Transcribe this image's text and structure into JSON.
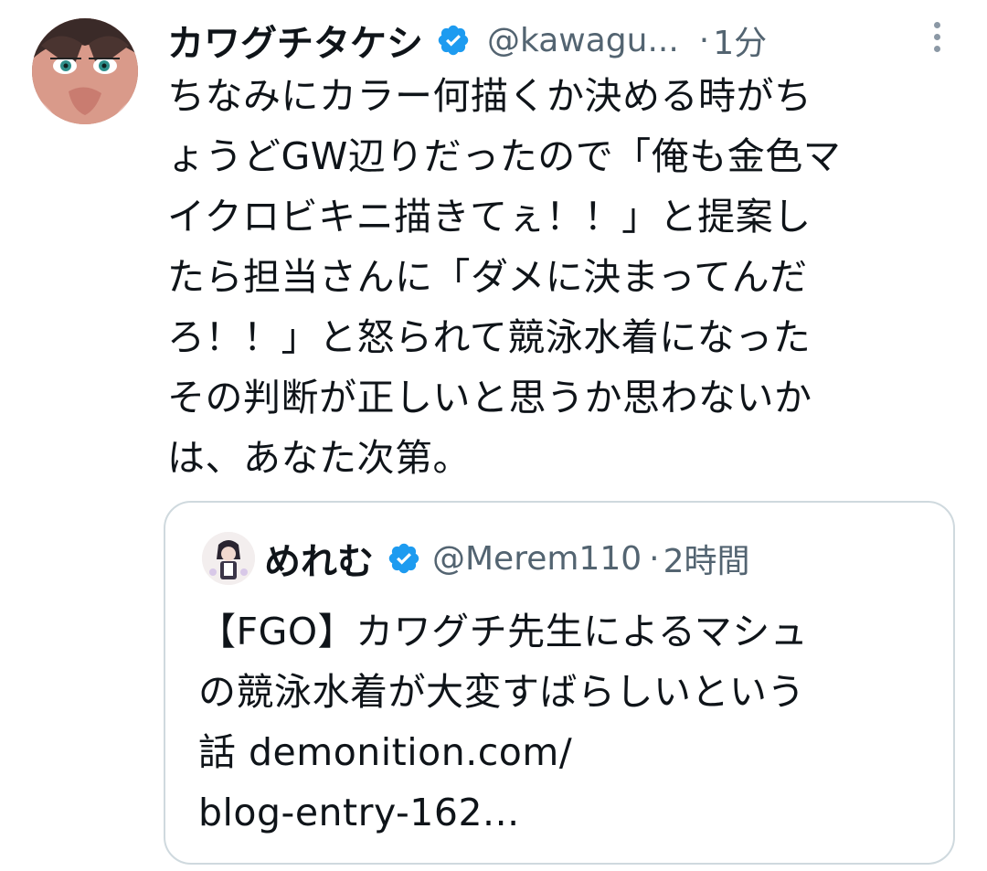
{
  "tweet": {
    "author": {
      "name": "カワグチタケシ",
      "handle": "@kawagu...",
      "time": "1分",
      "separator": "·"
    },
    "text": "ちなみにカラー何描くか決める時がち\nょうどGW辺りだったので「俺も金色マ\nイクロビキニ描きてぇ！！」と提案し\nたら担当さんに「ダメに決まってんだ\nろ！！」と怒られて競泳水着になった\nその判断が正しいと思うか思わないか\nは、あなた次第。",
    "more_icon": "more-vertical-icon",
    "verified_icon": "verified-badge-icon"
  },
  "quote": {
    "author": {
      "name": "めれむ",
      "handle": "@Merem110",
      "time": "2時間",
      "separator": "·"
    },
    "text": "【FGO】カワグチ先生によるマシュ\nの競泳水着が大変すばらしいという\n話 demonition.com/\nblog-entry-162..."
  },
  "colors": {
    "text": "#0f1419",
    "secondary": "#536471",
    "verified": "#1d9bf0",
    "border": "#cfd9de"
  }
}
